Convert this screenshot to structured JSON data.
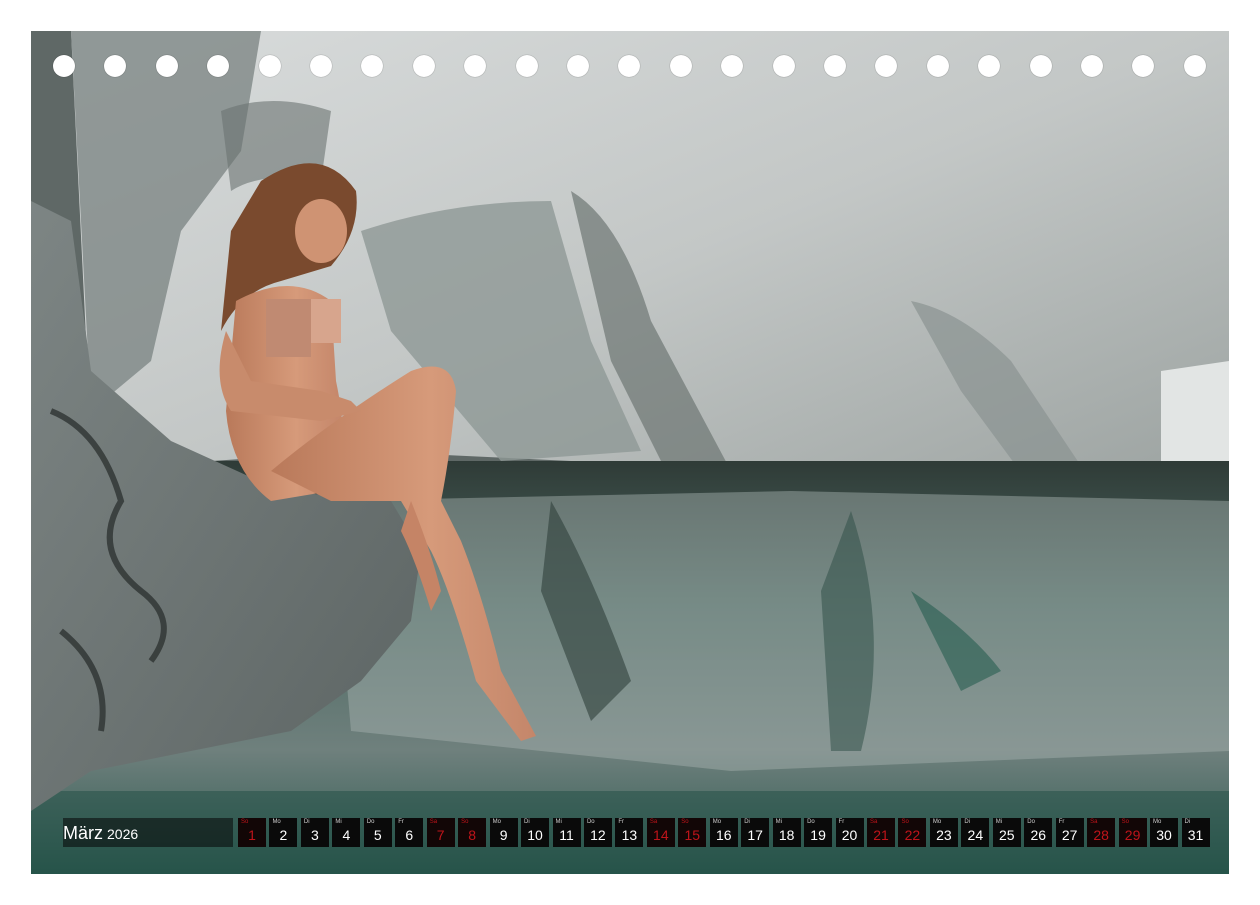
{
  "photo": {
    "subject": "nude-model-sitting-on-rock-by-river-pool"
  },
  "calendar": {
    "month": "März",
    "year": "2026",
    "days": [
      {
        "wd": "So",
        "n": "1",
        "red": true
      },
      {
        "wd": "Mo",
        "n": "2",
        "red": false
      },
      {
        "wd": "Di",
        "n": "3",
        "red": false
      },
      {
        "wd": "Mi",
        "n": "4",
        "red": false
      },
      {
        "wd": "Do",
        "n": "5",
        "red": false
      },
      {
        "wd": "Fr",
        "n": "6",
        "red": false
      },
      {
        "wd": "Sa",
        "n": "7",
        "red": true
      },
      {
        "wd": "So",
        "n": "8",
        "red": true
      },
      {
        "wd": "Mo",
        "n": "9",
        "red": false
      },
      {
        "wd": "Di",
        "n": "10",
        "red": false
      },
      {
        "wd": "Mi",
        "n": "11",
        "red": false
      },
      {
        "wd": "Do",
        "n": "12",
        "red": false
      },
      {
        "wd": "Fr",
        "n": "13",
        "red": false
      },
      {
        "wd": "Sa",
        "n": "14",
        "red": true
      },
      {
        "wd": "So",
        "n": "15",
        "red": true
      },
      {
        "wd": "Mo",
        "n": "16",
        "red": false
      },
      {
        "wd": "Di",
        "n": "17",
        "red": false
      },
      {
        "wd": "Mi",
        "n": "18",
        "red": false
      },
      {
        "wd": "Do",
        "n": "19",
        "red": false
      },
      {
        "wd": "Fr",
        "n": "20",
        "red": false
      },
      {
        "wd": "Sa",
        "n": "21",
        "red": true
      },
      {
        "wd": "So",
        "n": "22",
        "red": true
      },
      {
        "wd": "Mo",
        "n": "23",
        "red": false
      },
      {
        "wd": "Di",
        "n": "24",
        "red": false
      },
      {
        "wd": "Mi",
        "n": "25",
        "red": false
      },
      {
        "wd": "Do",
        "n": "26",
        "red": false
      },
      {
        "wd": "Fr",
        "n": "27",
        "red": false
      },
      {
        "wd": "Sa",
        "n": "28",
        "red": true
      },
      {
        "wd": "So",
        "n": "29",
        "red": true
      },
      {
        "wd": "Mo",
        "n": "30",
        "red": false
      },
      {
        "wd": "Di",
        "n": "31",
        "red": false
      }
    ]
  },
  "colors": {
    "weekday_text": "#ffffff",
    "weekend_text": "#c0141a",
    "cell_bg": "#0a0a0a",
    "water": "#3f6b62",
    "rock": "#b8bcbc"
  }
}
